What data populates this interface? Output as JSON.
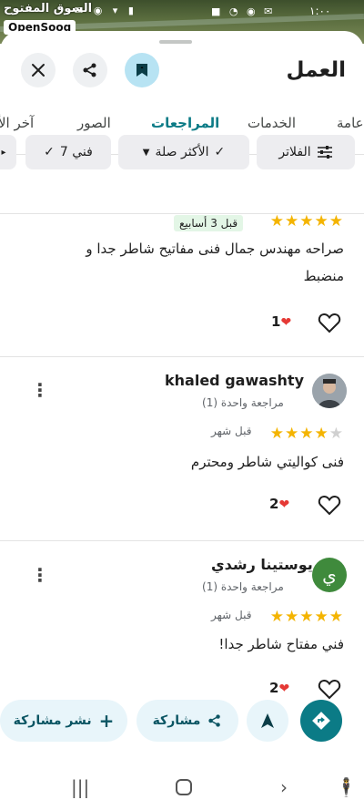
{
  "status": {
    "time": "١:٠٠",
    "icons": "■ ◔ ◉ ✉",
    "right_icons": "✉ ◉ ▾ ▮"
  },
  "watermark": {
    "arabic": "السوق المفتوح",
    "brand": "OpenSooq"
  },
  "header": {
    "title": "العمل"
  },
  "tabs": [
    {
      "label": "آخر الأ"
    },
    {
      "label": "الصور"
    },
    {
      "label": "المراجعات",
      "active": true
    },
    {
      "label": "الخدمات"
    },
    {
      "label": "عامة"
    }
  ],
  "chips": {
    "filters": "الفلاتر",
    "most_relevant": "الأكثر صلة",
    "tech": "فني 7"
  },
  "reviews": [
    {
      "rating": 5,
      "time": "قبل 3 أسابيع",
      "text_line1": "صراحه مهندس جمال فنى مفاتيح شاطر جدا و",
      "text_line2": "منضبط",
      "likes": "1"
    },
    {
      "name": "khaled gawashty",
      "count": "مراجعة واحدة (1)",
      "rating": 4,
      "time": "قبل شهر",
      "text_line1": "فنى كواليتي شاطر ومحترم",
      "likes": "2"
    },
    {
      "name": "يوستينا رشدي",
      "avatar_letter": "ي",
      "count": "مراجعة واحدة (1)",
      "rating": 5,
      "time": "قبل شهر",
      "text_line1": "فني مفتاح شاطر جدا!",
      "likes": "2"
    }
  ],
  "actions": {
    "post": "نشر مشاركة",
    "share": "مشاركة"
  },
  "colors": {
    "accent": "#0b7b86",
    "star": "#f4b400",
    "heart": "#e53935",
    "save_bg": "#b7e3f3"
  }
}
